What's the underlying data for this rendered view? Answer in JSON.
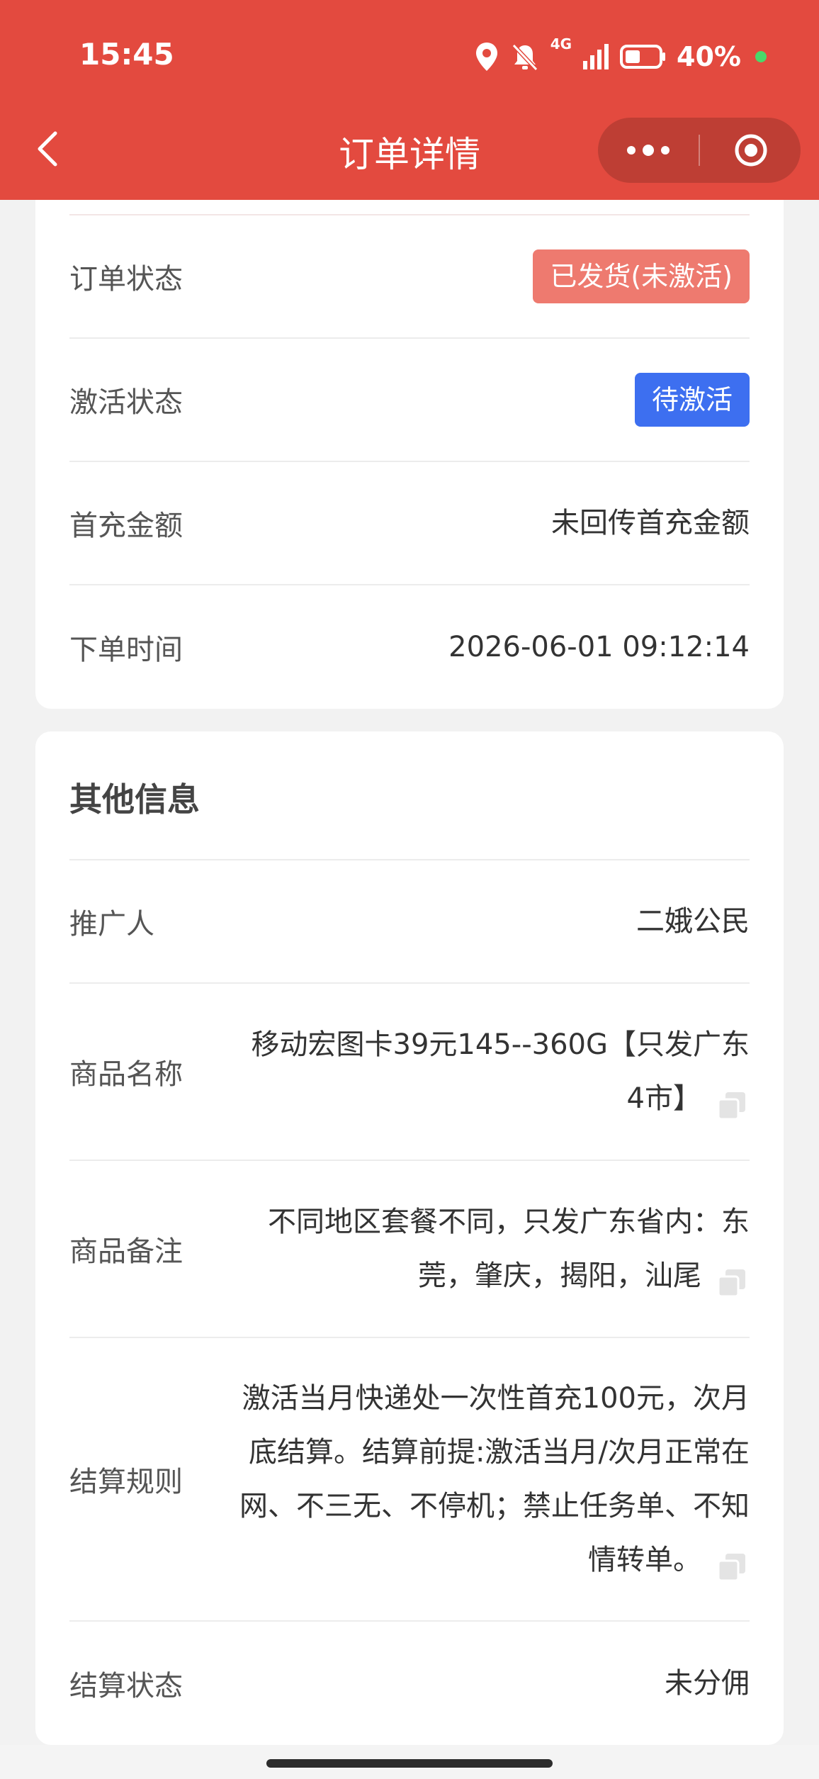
{
  "status_bar": {
    "time": "15:45",
    "battery_percent": "40%",
    "network": "4G"
  },
  "nav": {
    "title": "订单详情"
  },
  "order_card": {
    "rows": [
      {
        "label": "订单状态",
        "value": "已发货(未激活)"
      },
      {
        "label": "激活状态",
        "value": "待激活"
      },
      {
        "label": "首充金额",
        "value": "未回传首充金额"
      },
      {
        "label": "下单时间",
        "value": "2026-06-01 09:12:14"
      }
    ]
  },
  "other_card": {
    "title": "其他信息",
    "rows": [
      {
        "label": "推广人",
        "value": "二娥公民"
      },
      {
        "label": "商品名称",
        "value": "移动宏图卡39元145--360G【只发广东4市】"
      },
      {
        "label": "商品备注",
        "value": "不同地区套餐不同，只发广东省内：东莞，肇庆，揭阳，汕尾"
      },
      {
        "label": "结算规则",
        "value": "激活当月快递处一次性首充100元，次月底结算。结算前提:激活当月/次月正常在网、不三无、不停机；禁止任务单、不知情转单。"
      },
      {
        "label": "结算状态",
        "value": "未分佣"
      }
    ]
  },
  "colors": {
    "header": "#e34a3f",
    "badge_shipped": "#ee7a6f",
    "badge_pending": "#3d6ff0"
  }
}
